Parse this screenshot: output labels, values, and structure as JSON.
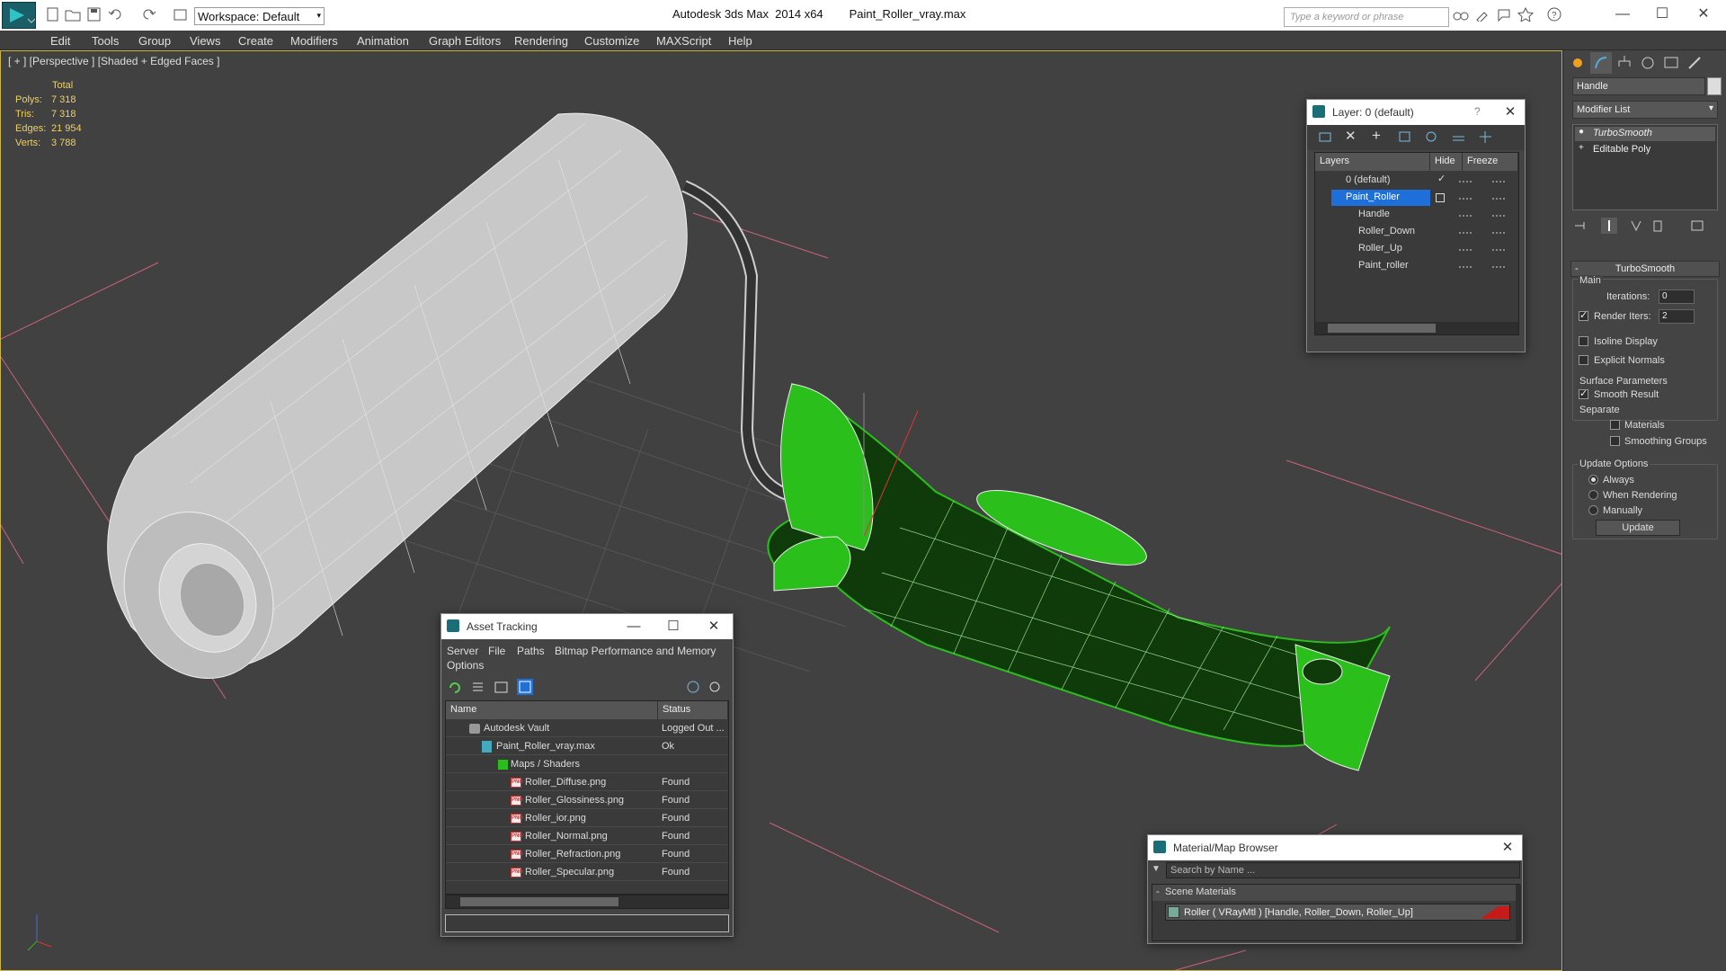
{
  "titlebar": {
    "app_title": "Autodesk 3ds Max  2014 x64",
    "file_name": "Paint_Roller_vray.max",
    "workspace": "Workspace: Default",
    "search_placeholder": "Type a keyword or phrase"
  },
  "menu": [
    "Edit",
    "Tools",
    "Group",
    "Views",
    "Create",
    "Modifiers",
    "Animation",
    "Graph Editors",
    "Rendering",
    "Customize",
    "MAXScript",
    "Help"
  ],
  "viewport": {
    "label": "[ + ] [Perspective ] [Shaded + Edged Faces ]",
    "stats": {
      "header": "Total",
      "rows": [
        {
          "label": "Polys:",
          "value": "7 318"
        },
        {
          "label": "Tris:",
          "value": "7 318"
        },
        {
          "label": "Edges:",
          "value": "21 954"
        },
        {
          "label": "Verts:",
          "value": "3 788"
        }
      ]
    }
  },
  "layer_dialog": {
    "title": "Layer: 0 (default)",
    "help": "?",
    "col_layers": "Layers",
    "col_hide": "Hide",
    "col_freeze": "Freeze",
    "rows": [
      "0 (default)",
      "Paint_Roller",
      "Handle",
      "Roller_Down",
      "Roller_Up",
      "Paint_roller"
    ]
  },
  "asset_tracking": {
    "title": "Asset Tracking",
    "menu": [
      "Server",
      "File",
      "Paths",
      "Bitmap Performance and Memory"
    ],
    "menu2": "Options",
    "col_name": "Name",
    "col_status": "Status",
    "rows": [
      {
        "name": "Autodesk Vault",
        "status": "Logged Out ..."
      },
      {
        "name": "Paint_Roller_vray.max",
        "status": "Ok"
      },
      {
        "name": "Maps / Shaders",
        "status": ""
      },
      {
        "name": "Roller_Diffuse.png",
        "status": "Found"
      },
      {
        "name": "Roller_Glossiness.png",
        "status": "Found"
      },
      {
        "name": "Roller_ior.png",
        "status": "Found"
      },
      {
        "name": "Roller_Normal.png",
        "status": "Found"
      },
      {
        "name": "Roller_Refraction.png",
        "status": "Found"
      },
      {
        "name": "Roller_Specular.png",
        "status": "Found"
      }
    ],
    "png_badge": "PNG"
  },
  "material_browser": {
    "title": "Material/Map Browser",
    "search_placeholder": "Search by Name ...",
    "section": "Scene Materials",
    "item": "Roller  ( VRayMtl )  [Handle, Roller_Down, Roller_Up]"
  },
  "command_panel": {
    "object_name": "Handle",
    "modifier_list": "Modifier List",
    "stack": [
      "TurboSmooth",
      "Editable Poly"
    ],
    "turbosmooth": {
      "title": "TurboSmooth",
      "main": "Main",
      "iterations_label": "Iterations:",
      "iterations": "0",
      "render_iters_label": "Render Iters:",
      "render_iters": "2",
      "isoline": "Isoline Display",
      "explicit": "Explicit Normals",
      "surface": "Surface Parameters",
      "smooth": "Smooth Result",
      "separate": "Separate",
      "materials": "Materials",
      "smoothing": "Smoothing Groups",
      "update_options": "Update Options",
      "always": "Always",
      "when_rendering": "When Rendering",
      "manually": "Manually",
      "update_btn": "Update"
    }
  },
  "colors": {
    "accent_selected": "#1e6fd9",
    "mesh_green": "#2bbf1c",
    "viewport_bg": "#414141"
  }
}
